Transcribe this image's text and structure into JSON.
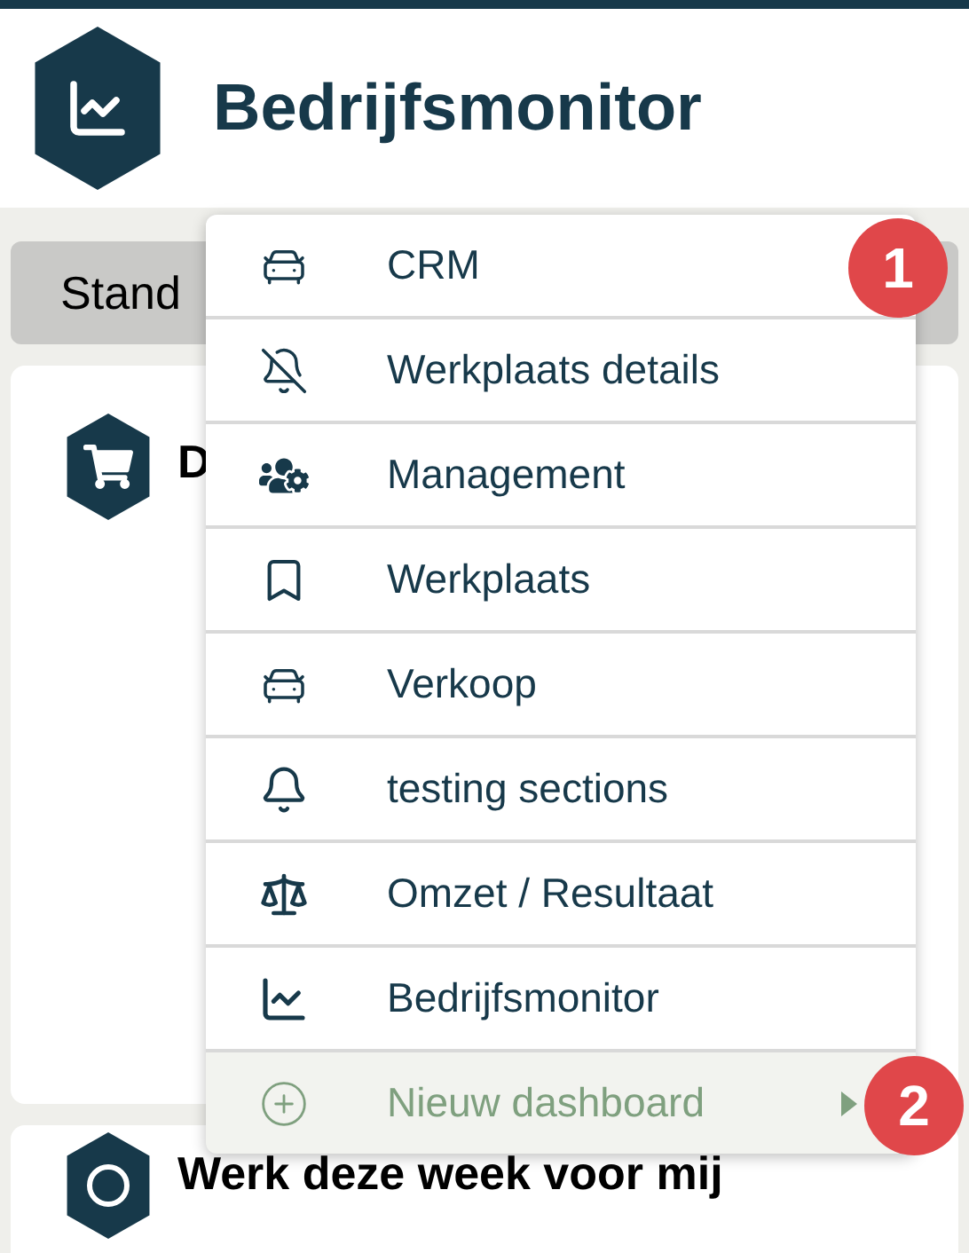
{
  "header": {
    "title": "Bedrijfsmonitor"
  },
  "tab": {
    "label": "Stand"
  },
  "cards": [
    {
      "title": "D"
    },
    {
      "title": "Werk deze week voor mij"
    }
  ],
  "menu": {
    "items": [
      {
        "kind": "dashboard",
        "label": "CRM",
        "badge": "1"
      },
      {
        "kind": "dashboard",
        "label": "Werkplaats details"
      },
      {
        "kind": "dashboard",
        "label": "Management"
      },
      {
        "kind": "dashboard",
        "label": "Werkplaats"
      },
      {
        "kind": "dashboard",
        "label": "Verkoop"
      },
      {
        "kind": "dashboard",
        "label": "testing sections"
      },
      {
        "kind": "dashboard",
        "label": "Omzet / Resultaat"
      },
      {
        "kind": "dashboard",
        "label": "Bedrijfsmonitor"
      },
      {
        "kind": "action",
        "label": "Nieuw dashboard",
        "badge": "2"
      }
    ]
  }
}
